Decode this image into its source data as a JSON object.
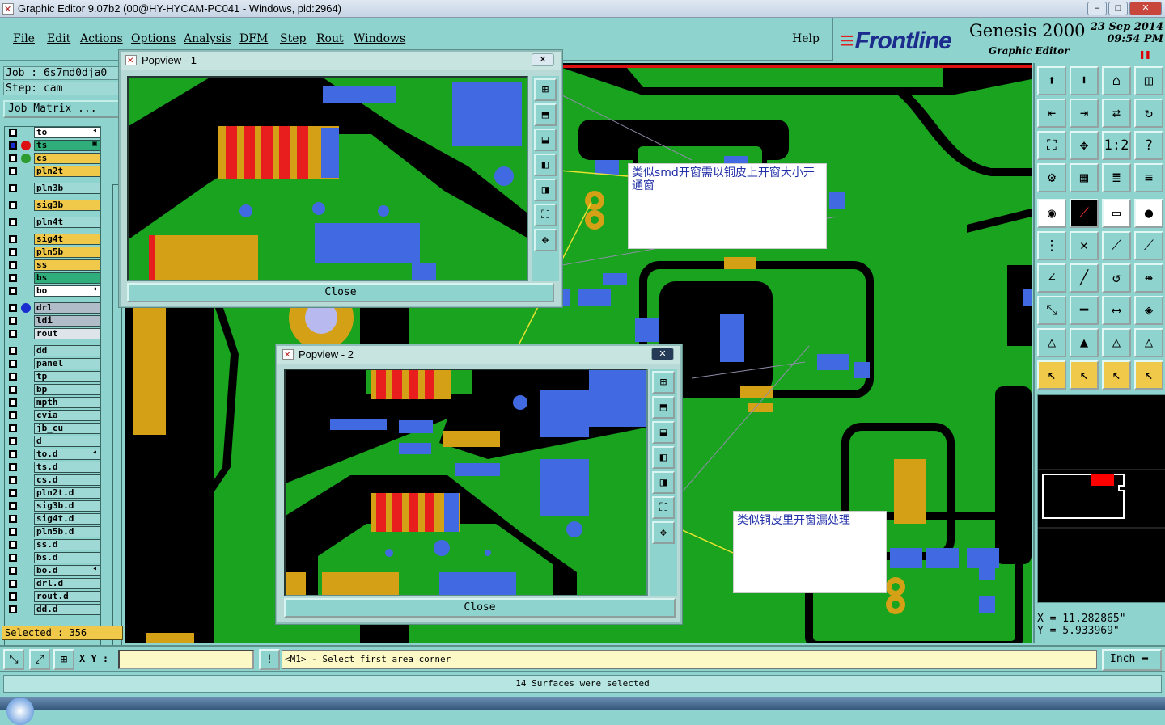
{
  "window": {
    "title": "Graphic Editor 9.07b2 (00@HY-HYCAM-PC041 - Windows, pid:2964)",
    "min": "–",
    "max": "□",
    "close": "✕"
  },
  "menu": [
    "File",
    "Edit",
    "Actions",
    "Options",
    "Analysis",
    "DFM",
    "Step",
    "Rout",
    "Windows"
  ],
  "help": "Help",
  "brand": {
    "logo": "Frontline",
    "product": "Genesis 2000",
    "subtitle": "Graphic Editor",
    "date": "23  Sep  2014",
    "time": "09:54  PM",
    "pause": "❚❚"
  },
  "job": "Job : 6s7md0dja0",
  "step": "Step: cam",
  "job_matrix": "Job Matrix ...",
  "layers": [
    {
      "name": "to",
      "color": "#ffffff",
      "marker": "",
      "arrow": "◂"
    },
    {
      "name": "ts",
      "color": "#2fae7c",
      "marker": "#d11",
      "arrow": "▣",
      "active": true
    },
    {
      "name": "cs",
      "color": "#f0c94a",
      "marker": "#2e9b2e",
      "arrow": ""
    },
    {
      "name": "pln2t",
      "color": "#f0c94a",
      "marker": "",
      "arrow": ""
    },
    {
      "name": "pln3b",
      "color": "#9fd9d5",
      "marker": "",
      "arrow": ""
    },
    {
      "name": "sig3b",
      "color": "#f0c94a",
      "marker": "",
      "arrow": ""
    },
    {
      "name": "pln4t",
      "color": "#9fd9d5",
      "marker": "",
      "arrow": ""
    },
    {
      "name": "sig4t",
      "color": "#f0c94a",
      "marker": "",
      "arrow": ""
    },
    {
      "name": "pln5b",
      "color": "#f0c94a",
      "marker": "",
      "arrow": ""
    },
    {
      "name": "ss",
      "color": "#f0c94a",
      "marker": "",
      "arrow": ""
    },
    {
      "name": "bs",
      "color": "#2fae7c",
      "marker": "",
      "arrow": ""
    },
    {
      "name": "bo",
      "color": "#ffffff",
      "marker": "",
      "arrow": "◂"
    },
    {
      "name": "drl",
      "color": "#b0bcc8",
      "marker": "#1a2ecf",
      "arrow": ""
    },
    {
      "name": "ldi",
      "color": "#b0bcc8",
      "marker": "",
      "arrow": ""
    },
    {
      "name": "rout",
      "color": "#dde4ea",
      "marker": "",
      "arrow": ""
    },
    {
      "name": "dd",
      "color": "#9fd9d5",
      "marker": "",
      "arrow": ""
    },
    {
      "name": "panel",
      "color": "#9fd9d5",
      "marker": "",
      "arrow": ""
    },
    {
      "name": "tp",
      "color": "#9fd9d5",
      "marker": "",
      "arrow": ""
    },
    {
      "name": "bp",
      "color": "#9fd9d5",
      "marker": "",
      "arrow": ""
    },
    {
      "name": "mpth",
      "color": "#9fd9d5",
      "marker": "",
      "arrow": ""
    },
    {
      "name": "cvia",
      "color": "#9fd9d5",
      "marker": "",
      "arrow": ""
    },
    {
      "name": "jb_cu",
      "color": "#9fd9d5",
      "marker": "",
      "arrow": ""
    },
    {
      "name": "d",
      "color": "#9fd9d5",
      "marker": "",
      "arrow": ""
    },
    {
      "name": "to.d",
      "color": "#9fd9d5",
      "marker": "",
      "arrow": "◂"
    },
    {
      "name": "ts.d",
      "color": "#9fd9d5",
      "marker": "",
      "arrow": ""
    },
    {
      "name": "cs.d",
      "color": "#9fd9d5",
      "marker": "",
      "arrow": ""
    },
    {
      "name": "pln2t.d",
      "color": "#9fd9d5",
      "marker": "",
      "arrow": ""
    },
    {
      "name": "sig3b.d",
      "color": "#9fd9d5",
      "marker": "",
      "arrow": ""
    },
    {
      "name": "sig4t.d",
      "color": "#9fd9d5",
      "marker": "",
      "arrow": ""
    },
    {
      "name": "pln5b.d",
      "color": "#9fd9d5",
      "marker": "",
      "arrow": ""
    },
    {
      "name": "ss.d",
      "color": "#9fd9d5",
      "marker": "",
      "arrow": ""
    },
    {
      "name": "bs.d",
      "color": "#9fd9d5",
      "marker": "",
      "arrow": ""
    },
    {
      "name": "bo.d",
      "color": "#9fd9d5",
      "marker": "",
      "arrow": "◂"
    },
    {
      "name": "drl.d",
      "color": "#9fd9d5",
      "marker": "",
      "arrow": ""
    },
    {
      "name": "rout.d",
      "color": "#9fd9d5",
      "marker": "",
      "arrow": ""
    },
    {
      "name": "dd.d",
      "color": "#9fd9d5",
      "marker": "",
      "arrow": ""
    }
  ],
  "selected": "Selected : 356",
  "popview1": {
    "title": "Popview - 1",
    "close": "Close",
    "x": "✕"
  },
  "popview2": {
    "title": "Popview - 2",
    "close": "Close",
    "x": "✕"
  },
  "notes": {
    "note1": "类似smd开窗需以铜皮上开窗大小开通窗",
    "note2": "类似铜皮里开窗漏处理"
  },
  "coords": {
    "x": "X = 11.282865\"",
    "y": "Y = 5.933969\""
  },
  "xy_label": "X Y :",
  "prompt": "<M1> - Select first area corner",
  "unit": "Inch",
  "status": "14 Surfaces were selected",
  "colors": {
    "background": "#8fd3cf",
    "board": "#19a31f",
    "pad_blue": "#4169e1",
    "pad_yellow": "#d4a015",
    "pad_red": "#e81d1d"
  }
}
